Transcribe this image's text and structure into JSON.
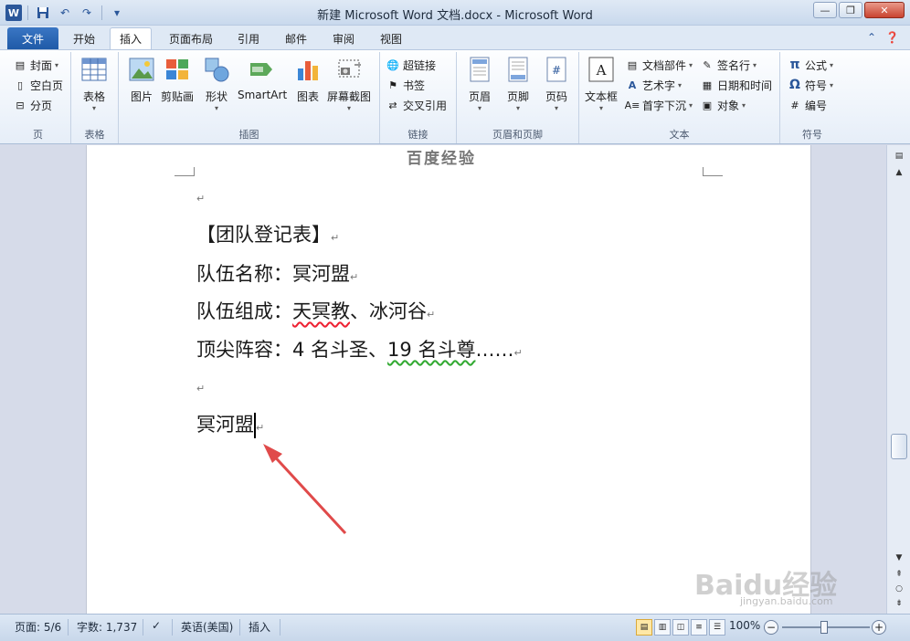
{
  "window": {
    "title": "新建 Microsoft Word 文档.docx - Microsoft Word",
    "word_logo": "W"
  },
  "tabs": [
    {
      "label": "文件"
    },
    {
      "label": "开始"
    },
    {
      "label": "插入"
    },
    {
      "label": "页面布局"
    },
    {
      "label": "引用"
    },
    {
      "label": "邮件"
    },
    {
      "label": "审阅"
    },
    {
      "label": "视图"
    }
  ],
  "active_tab": "插入",
  "ribbon": {
    "pages": {
      "label": "页",
      "items": [
        "封面",
        "空白页",
        "分页"
      ]
    },
    "tables": {
      "label": "表格",
      "items": [
        "表格"
      ]
    },
    "illustrations": {
      "label": "插图",
      "items": [
        "图片",
        "剪贴画",
        "形状",
        "SmartArt",
        "图表",
        "屏幕截图"
      ]
    },
    "links": {
      "label": "链接",
      "items": [
        "超链接",
        "书签",
        "交叉引用"
      ]
    },
    "header_footer": {
      "label": "页眉和页脚",
      "items": [
        "页眉",
        "页脚",
        "页码"
      ]
    },
    "text": {
      "label": "文本",
      "items": [
        "文本框",
        "文档部件",
        "艺术字",
        "首字下沉",
        "签名行",
        "日期和时间",
        "对象"
      ]
    },
    "symbols": {
      "label": "符号",
      "items": [
        "公式",
        "符号",
        "编号"
      ]
    }
  },
  "document": {
    "header_watermark": "百度经验",
    "lines": [
      {
        "text": "【团队登记表】"
      },
      {
        "text": "队伍名称：冥河盟"
      },
      {
        "label": "队伍组成：",
        "red": "天冥教",
        "rest": "、冰河谷"
      },
      {
        "label": "顶尖阵容：4 名斗圣、",
        "green": "19 名斗尊",
        "rest": "……"
      }
    ],
    "typed_text": "冥河盟",
    "para_mark": "↵"
  },
  "status_bar": {
    "page": "页面: 5/6",
    "words": "字数: 1,737",
    "language": "英语(美国)",
    "mode": "插入",
    "zoom": "100%",
    "zoom_level": 1.0
  },
  "watermark": {
    "brand": "Baidu经验",
    "url": "jingyan.baidu.com"
  },
  "colors": {
    "accent": "#2b579a",
    "file_tab": "#1f5aa7",
    "annotation_arrow": "#e04a4a"
  }
}
